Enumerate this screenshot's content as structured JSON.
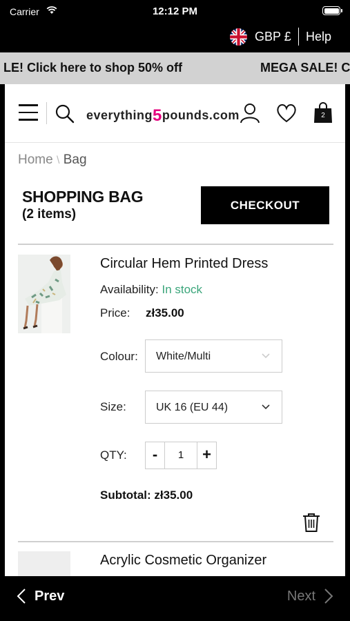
{
  "status": {
    "carrier": "Carrier",
    "time": "12:12 PM"
  },
  "topbar": {
    "currency": "GBP £",
    "help": "Help"
  },
  "promo": {
    "text_left": "LE! Click here to shop 50% off",
    "text_right": "MEGA SALE! C"
  },
  "header": {
    "logo_pre": "everything",
    "logo_num": "5",
    "logo_post": "pounds.com",
    "bag_count": "2"
  },
  "breadcrumb": {
    "home": "Home",
    "sep": "\\",
    "current": "Bag"
  },
  "bag": {
    "title": "SHOPPING BAG",
    "count": "(2 items)",
    "checkout_label": "CHECKOUT"
  },
  "item1": {
    "name": "Circular Hem Printed Dress",
    "availability_label": "Availability:",
    "availability_value": "In stock",
    "price_label": "Price:",
    "price_value": "zł35.00",
    "colour_label": "Colour:",
    "colour_value": "White/Multi",
    "size_label": "Size:",
    "size_value": "UK 16 (EU 44)",
    "qty_label": "QTY:",
    "qty_minus": "-",
    "qty_value": "1",
    "qty_plus": "+",
    "subtotal_label": "Subtotal:",
    "subtotal_value": "zł35.00"
  },
  "item2": {
    "name": "Acrylic Cosmetic Organizer"
  },
  "nav": {
    "prev": "Prev",
    "next": "Next"
  },
  "colors": {
    "accent_pink": "#e6007e",
    "in_stock_green": "#3aa57a",
    "promo_bg": "#d2d2d2"
  }
}
